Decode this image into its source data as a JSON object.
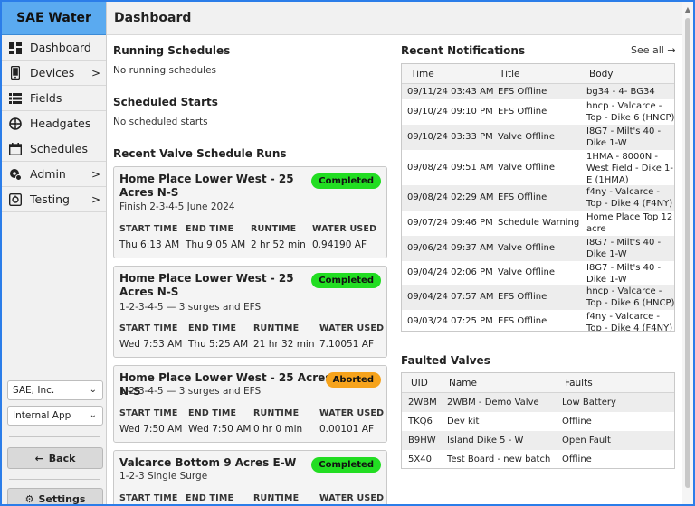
{
  "sidebar": {
    "brand": "SAE Water",
    "items": [
      {
        "label": "Dashboard",
        "icon": "dashboard-icon",
        "chevron": false
      },
      {
        "label": "Devices",
        "icon": "phone-icon",
        "chevron": true
      },
      {
        "label": "Fields",
        "icon": "list-icon",
        "chevron": false
      },
      {
        "label": "Headgates",
        "icon": "valve-icon",
        "chevron": false
      },
      {
        "label": "Schedules",
        "icon": "calendar-icon",
        "chevron": false
      },
      {
        "label": "Admin",
        "icon": "admin-gear-icon",
        "chevron": true
      },
      {
        "label": "Testing",
        "icon": "testing-icon",
        "chevron": true
      }
    ],
    "org_select": "SAE, Inc.",
    "app_select": "Internal App",
    "back_label": "Back",
    "settings_label": "Settings"
  },
  "header": {
    "title": "Dashboard"
  },
  "running": {
    "title": "Running Schedules",
    "empty": "No running schedules"
  },
  "scheduled": {
    "title": "Scheduled Starts",
    "empty": "No scheduled starts"
  },
  "runs": {
    "title": "Recent Valve Schedule Runs",
    "columns": [
      "START TIME",
      "END TIME",
      "RUNTIME",
      "WATER USED"
    ],
    "items": [
      {
        "title": "Home Place Lower West - 25 Acres N-S",
        "subtitle": "Finish 2-3-4-5 June 2024",
        "status": "Completed",
        "start": "Thu 6:13 AM",
        "end": "Thu 9:05 AM",
        "runtime": "2 hr 52 min",
        "water": "0.94190 AF"
      },
      {
        "title": "Home Place Lower West - 25 Acres N-S",
        "subtitle": "1-2-3-4-5 — 3 surges and EFS",
        "status": "Completed",
        "start": "Wed 7:53 AM",
        "end": "Thu 5:25 AM",
        "runtime": "21 hr 32 min",
        "water": "7.10051 AF"
      },
      {
        "title": "Home Place Lower West - 25 Acres N-S",
        "subtitle": "1-2-3-4-5 — 3 surges and EFS",
        "status": "Aborted",
        "start": "Wed 7:50 AM",
        "end": "Wed 7:50 AM",
        "runtime": "0 hr 0 min",
        "water": "0.00101 AF"
      },
      {
        "title": "Valcarce Bottom 9 Acres E-W",
        "subtitle": "1-2-3 Single Surge",
        "status": "Completed",
        "start": "",
        "end": "",
        "runtime": "",
        "water": ""
      }
    ]
  },
  "notifications": {
    "title": "Recent Notifications",
    "see_all": "See all →",
    "columns": [
      "Time",
      "Title",
      "Body"
    ],
    "rows": [
      {
        "time": "09/11/24 03:43 AM",
        "title": "EFS Offline",
        "body": "bg34 - 4- BG34"
      },
      {
        "time": "09/10/24 09:10 PM",
        "title": "EFS Offline",
        "body": "hncp - Valcarce - Top - Dike 6 (HNCP)"
      },
      {
        "time": "09/10/24 03:33 PM",
        "title": "Valve Offline",
        "body": "I8G7 - Milt's 40 - Dike 1-W"
      },
      {
        "time": "09/08/24 09:51 AM",
        "title": "Valve Offline",
        "body": "1HMA - 8000N - West Field - Dike 1-E (1HMA)"
      },
      {
        "time": "09/08/24 02:29 AM",
        "title": "EFS Offline",
        "body": "f4ny - Valcarce - Top - Dike 4 (F4NY)"
      },
      {
        "time": "09/07/24 09:46 PM",
        "title": "Schedule Warning",
        "body": "Home Place Top 12 acre"
      },
      {
        "time": "09/06/24 09:37 AM",
        "title": "Valve Offline",
        "body": "I8G7 - Milt's 40 - Dike 1-W"
      },
      {
        "time": "09/04/24 02:06 PM",
        "title": "Valve Offline",
        "body": "I8G7 - Milt's 40 - Dike 1-W"
      },
      {
        "time": "09/04/24 07:57 AM",
        "title": "EFS Offline",
        "body": "hncp - Valcarce - Top - Dike 6 (HNCP)"
      },
      {
        "time": "09/03/24 07:25 PM",
        "title": "EFS Offline",
        "body": "f4ny - Valcarce - Top - Dike 4 (F4NY)"
      }
    ]
  },
  "faulted": {
    "title": "Faulted Valves",
    "columns": [
      "UID",
      "Name",
      "Faults"
    ],
    "rows": [
      {
        "uid": "2WBM",
        "name": "2WBM - Demo Valve",
        "faults": "Low Battery"
      },
      {
        "uid": "TKQ6",
        "name": "Dev kit",
        "faults": "Offline"
      },
      {
        "uid": "B9HW",
        "name": "Island Dike 5 - W",
        "faults": "Open Fault"
      },
      {
        "uid": "5X40",
        "name": "Test Board - new batch",
        "faults": "Offline"
      }
    ]
  }
}
